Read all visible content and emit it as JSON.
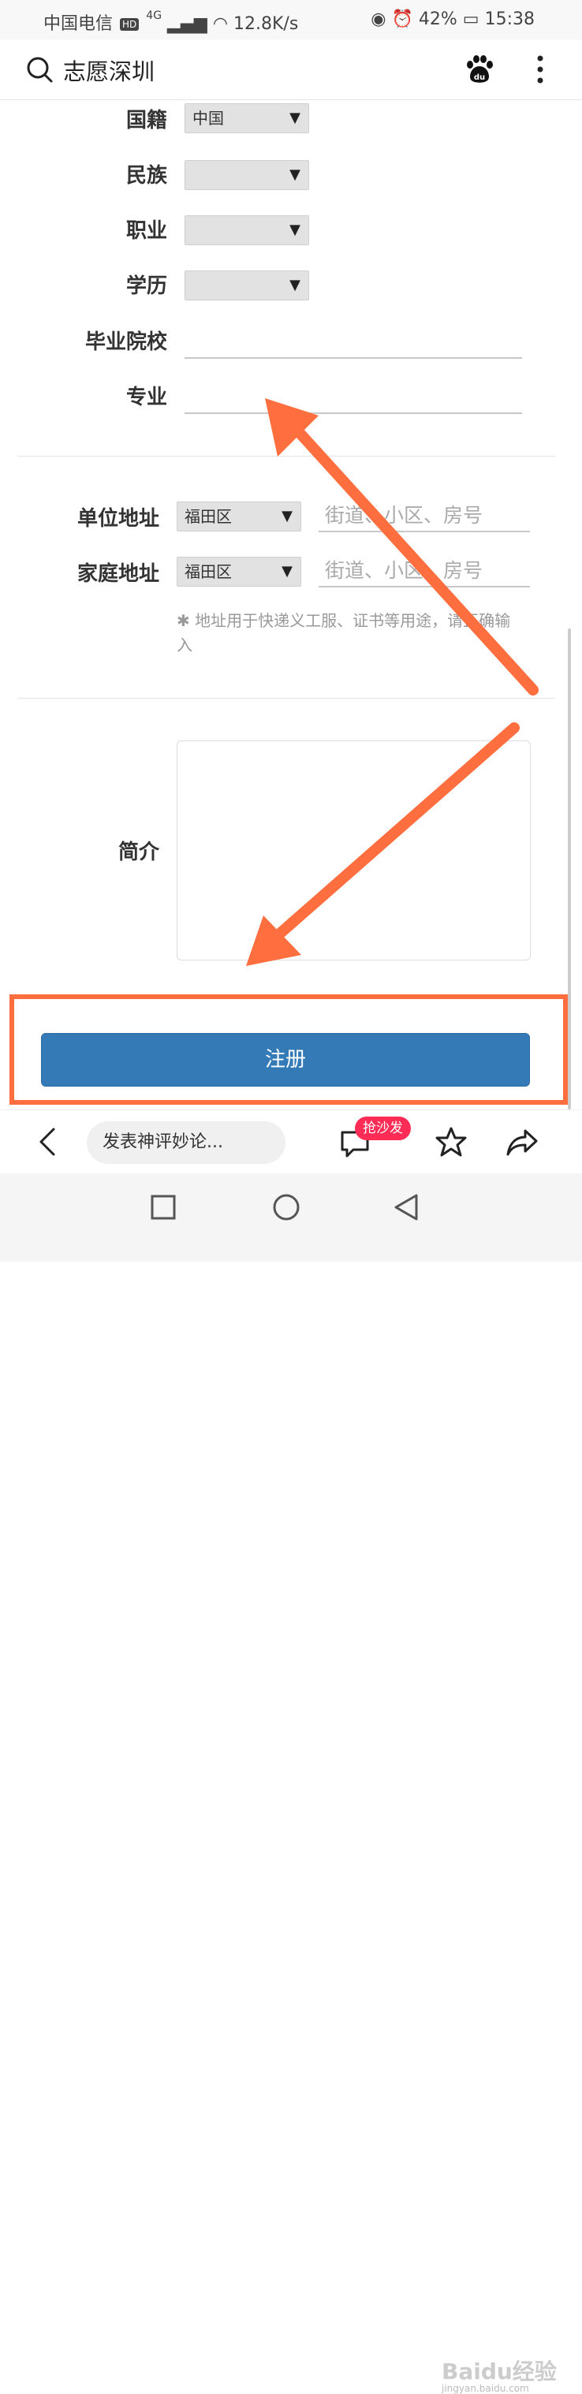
{
  "status_bar": {
    "carrier": "中国电信",
    "hd": "HD",
    "network": "4G",
    "speed": "12.8K/s",
    "battery": "42%",
    "time": "15:38"
  },
  "header": {
    "title": "志愿深圳"
  },
  "form": {
    "nationality": {
      "label": "国籍",
      "value": "中国"
    },
    "ethnicity": {
      "label": "民族",
      "value": ""
    },
    "occupation": {
      "label": "职业",
      "value": ""
    },
    "education": {
      "label": "学历",
      "value": ""
    },
    "school": {
      "label": "毕业院校",
      "value": ""
    },
    "major": {
      "label": "专业",
      "value": ""
    },
    "work_address": {
      "label": "单位地址",
      "district": "福田区",
      "placeholder": "街道、小区、房号"
    },
    "home_address": {
      "label": "家庭地址",
      "district": "福田区",
      "placeholder": "街道、小区、房号"
    },
    "address_note": "地址用于快递义工服、证书等用途，请正确输入",
    "bio": {
      "label": "简介"
    },
    "submit_label": "注册"
  },
  "bottom_bar": {
    "comment_placeholder": "发表神评妙论...",
    "badge": "抢沙发"
  },
  "watermark": {
    "brand": "Baidu经验",
    "url": "jingyan.baidu.com"
  },
  "colors": {
    "accent_button": "#337ab7",
    "highlight_frame": "#ff6e3f",
    "badge": "#ff2d55"
  }
}
